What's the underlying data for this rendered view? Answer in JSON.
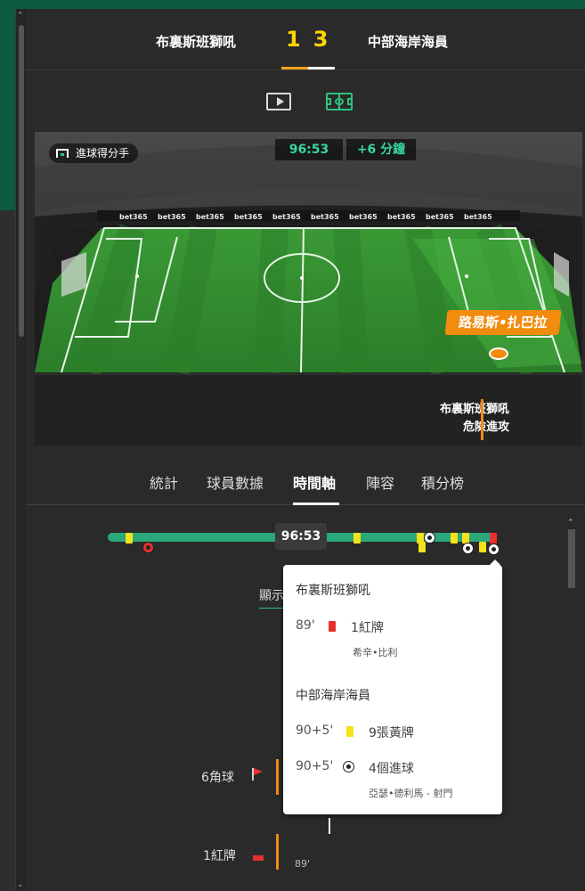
{
  "match": {
    "home_team": "布裏斯班獅吼",
    "away_team": "中部海岸海員",
    "home_score": "1",
    "away_score": "3"
  },
  "stadium": {
    "badge_label": "進球得分手",
    "clock": "96:53",
    "added_time": "+6 分鐘",
    "player_name": "路易斯•扎巴拉",
    "event_team": "布裏斯班獅吼",
    "event_label": "危險進攻",
    "advert": "bet365"
  },
  "tabs": [
    {
      "label": "統計"
    },
    {
      "label": "球員數據"
    },
    {
      "label": "時間軸"
    },
    {
      "label": "陣容"
    },
    {
      "label": "積分榜"
    }
  ],
  "timeline": {
    "clock": "96:53",
    "show_link": "顯示",
    "stats": [
      {
        "label": "6角球"
      },
      {
        "label": "1紅牌"
      }
    ],
    "partial_minute": "89'"
  },
  "tooltip": {
    "home_team": "布裏斯班獅吼",
    "home_events": [
      {
        "minute": "89'",
        "desc": "1紅牌",
        "sub": "希辛•比利"
      }
    ],
    "away_team": "中部海岸海員",
    "away_events": [
      {
        "minute": "90+5'",
        "desc": "9張黃牌",
        "sub": ""
      },
      {
        "minute": "90+5'",
        "desc": "4個進球",
        "sub": "亞瑟•德利馬 - 射門"
      }
    ]
  },
  "colors": {
    "accent_green": "#2ec27e",
    "score_yellow": "#ffd700",
    "orange": "#f28c0e",
    "pitch": "#2f8a2f"
  }
}
